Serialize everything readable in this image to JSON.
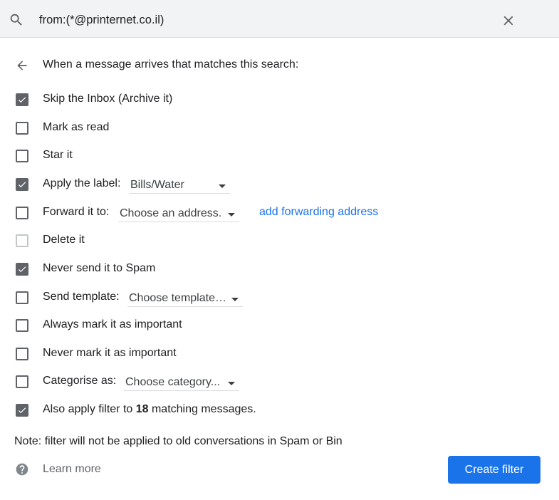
{
  "search": {
    "query": "from:(*@printernet.co.il)"
  },
  "header": {
    "text": "When a message arrives that matches this search:"
  },
  "options": {
    "skip_inbox": {
      "label": "Skip the Inbox (Archive it)",
      "checked": true
    },
    "mark_read": {
      "label": "Mark as read",
      "checked": false
    },
    "star": {
      "label": "Star it",
      "checked": false
    },
    "apply_label": {
      "label": "Apply the label:",
      "checked": true,
      "select_value": "Bills/Water"
    },
    "forward": {
      "label": "Forward it to:",
      "checked": false,
      "select_value": "Choose an address.",
      "link": "add forwarding address"
    },
    "delete": {
      "label": "Delete it",
      "checked": false,
      "disabled": true
    },
    "never_spam": {
      "label": "Never send it to Spam",
      "checked": true
    },
    "send_template": {
      "label": "Send template:",
      "checked": false,
      "select_value": "Choose template…"
    },
    "always_important": {
      "label": "Always mark it as important",
      "checked": false
    },
    "never_important": {
      "label": "Never mark it as important",
      "checked": false
    },
    "categorise": {
      "label": "Categorise as:",
      "checked": false,
      "select_value": "Choose category..."
    },
    "also_apply": {
      "label_before": "Also apply filter to ",
      "count": "18",
      "label_after": " matching messages.",
      "checked": true
    }
  },
  "note": "Note: filter will not be applied to old conversations in Spam or Bin",
  "learn_more": "Learn more",
  "create_button": "Create filter",
  "colors": {
    "accent": "#1a73e8",
    "checkbox": "#5f6368",
    "search_bg": "#f1f3f4"
  },
  "icons": {
    "search": "search-icon",
    "close": "close-icon",
    "back": "arrow-back-icon",
    "help": "help-icon"
  }
}
